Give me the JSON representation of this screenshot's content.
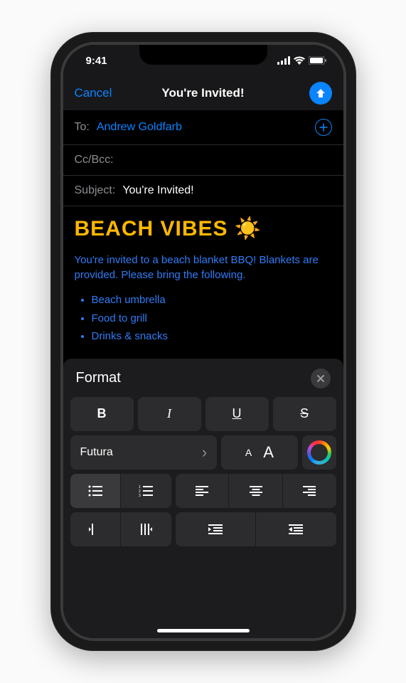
{
  "status": {
    "time": "9:41"
  },
  "nav": {
    "cancel": "Cancel",
    "title": "You're Invited!"
  },
  "compose": {
    "to_label": "To:",
    "to_value": "Andrew Goldfarb",
    "cc_label": "Cc/Bcc:",
    "subject_label": "Subject:",
    "subject_value": "You're Invited!"
  },
  "body": {
    "headline": "BEACH VIBES ☀️",
    "paragraph": "You're invited to a beach blanket BBQ! Blankets are provided. Please bring the following.",
    "items": [
      "Beach umbrella",
      "Food to grill",
      "Drinks & snacks"
    ]
  },
  "format": {
    "title": "Format",
    "bold": "B",
    "italic": "I",
    "underline": "U",
    "strike": "S",
    "font_name": "Futura",
    "chevron": "›",
    "size_small": "A",
    "size_large": "A"
  }
}
